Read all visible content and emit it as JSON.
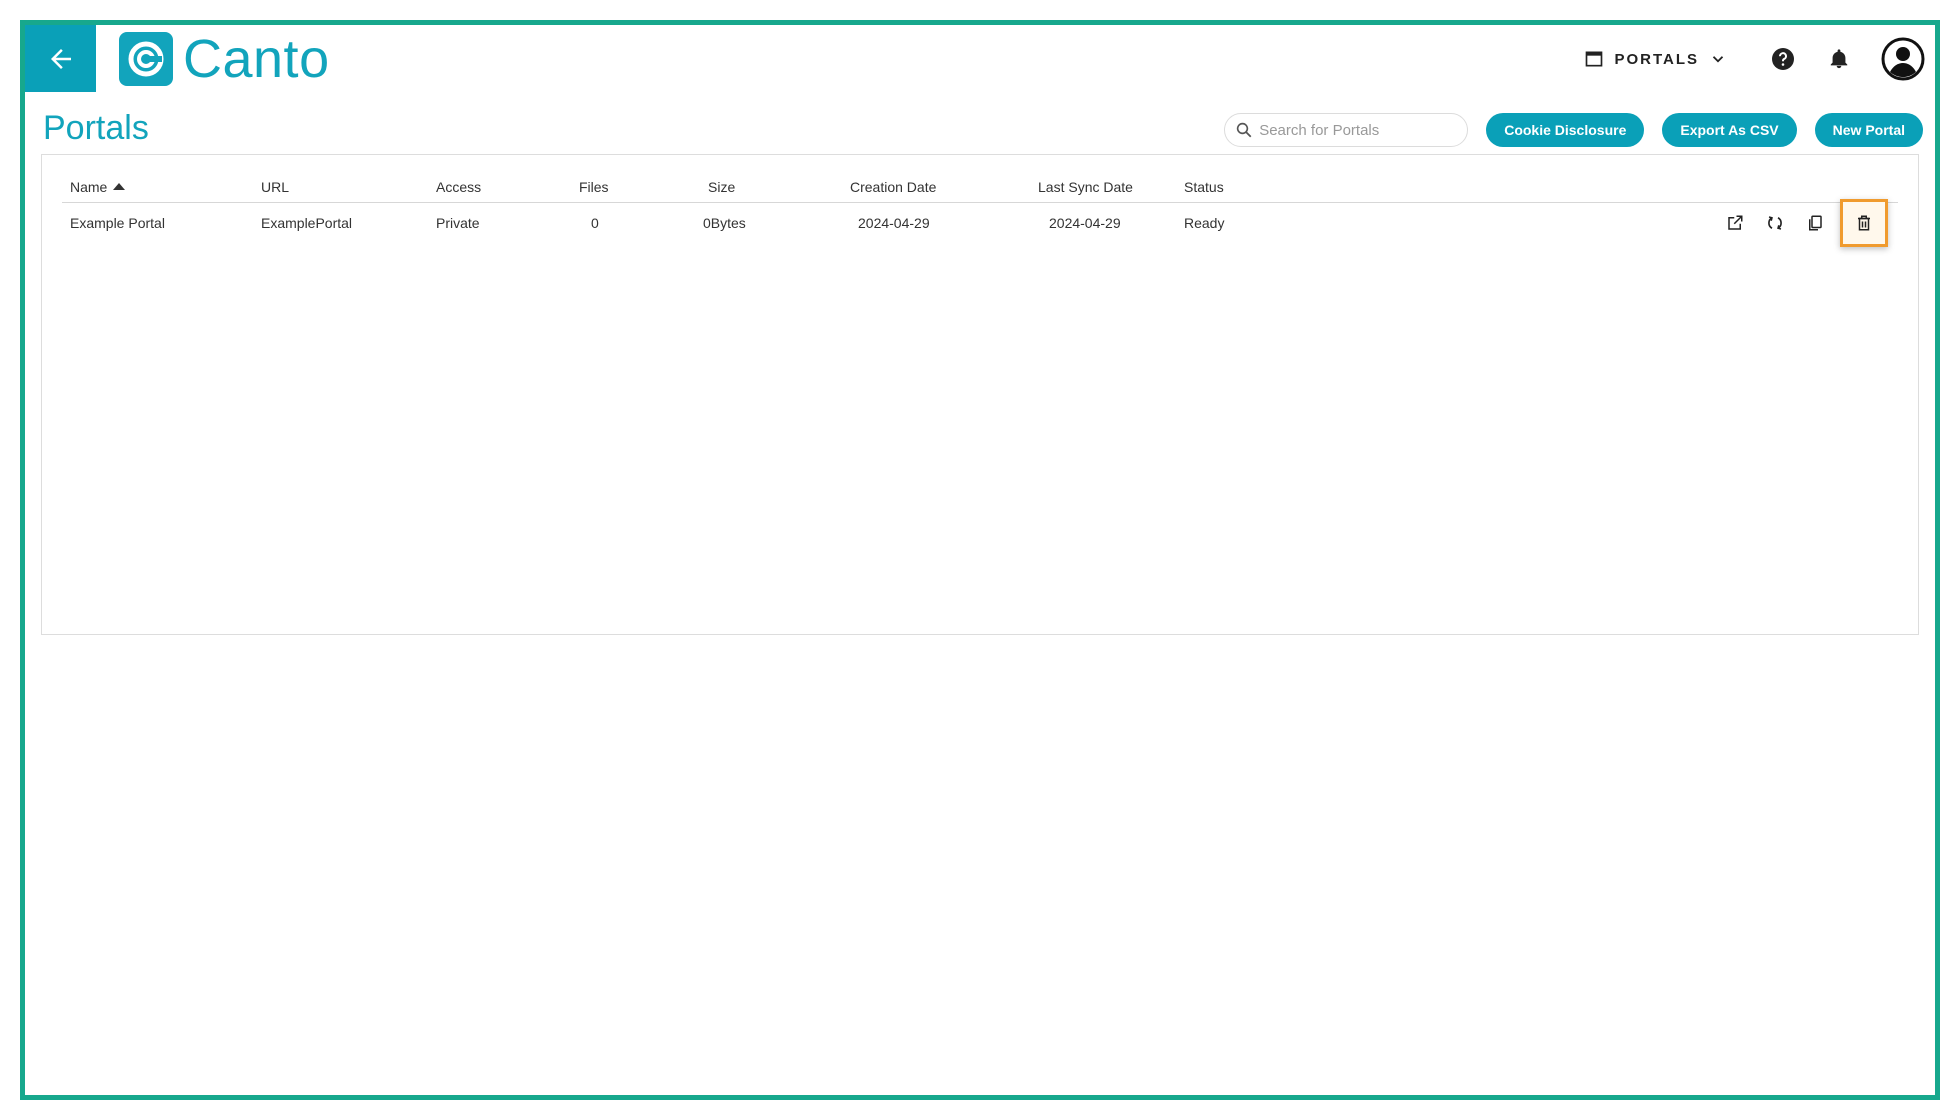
{
  "header": {
    "logo_text": "Canto",
    "portals_switch_label": "PORTALS"
  },
  "page": {
    "title": "Portals"
  },
  "toolbar": {
    "search_placeholder": "Search for Portals",
    "cookie_label": "Cookie Disclosure",
    "export_label": "Export As CSV",
    "new_label": "New Portal"
  },
  "table": {
    "columns": [
      "Name",
      "URL",
      "Access",
      "Files",
      "Size",
      "Creation Date",
      "Last Sync Date",
      "Status"
    ],
    "rows": [
      {
        "name": "Example Portal",
        "url": "ExamplePortal",
        "access": "Private",
        "files": "0",
        "size": "0Bytes",
        "creation_date": "2024-04-29",
        "last_sync_date": "2024-04-29",
        "status": "Ready"
      }
    ]
  },
  "colors": {
    "accent": "#0aa0b8",
    "frame": "#17a88d",
    "highlight": "#f09b2e"
  }
}
